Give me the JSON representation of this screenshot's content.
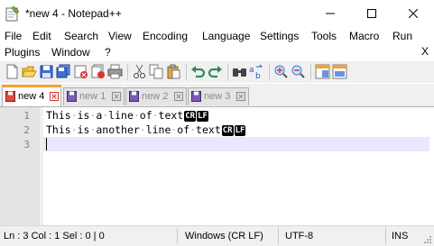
{
  "window": {
    "title": "*new 4 - Notepad++"
  },
  "menubar": {
    "items": [
      "File",
      "Edit",
      "Search",
      "View",
      "Encoding",
      "Language",
      "Settings",
      "Tools",
      "Macro",
      "Run",
      "Plugins",
      "Window",
      "?"
    ],
    "close_glyph": "X"
  },
  "toolbar": {
    "icons": [
      "new-file-icon",
      "open-file-icon",
      "save-icon",
      "save-all-icon",
      "close-icon",
      "close-all-icon",
      "print-icon",
      "cut-icon",
      "copy-icon",
      "paste-icon",
      "undo-icon",
      "redo-icon",
      "find-icon",
      "replace-icon",
      "zoom-in-icon",
      "zoom-out-icon",
      "sync-vertical-icon",
      "sync-horizontal-icon"
    ]
  },
  "tabs": [
    {
      "label": "new 4",
      "active": true
    },
    {
      "label": "new 1",
      "active": false
    },
    {
      "label": "new 2",
      "active": false
    },
    {
      "label": "new 3",
      "active": false
    }
  ],
  "editor": {
    "line_numbers": [
      "1",
      "2",
      "3"
    ],
    "lines": [
      {
        "words": [
          "This",
          "is",
          "a",
          "line",
          "of",
          "text"
        ],
        "eol": [
          "CR",
          "LF"
        ]
      },
      {
        "words": [
          "This",
          "is",
          "another",
          "line",
          "of",
          "text"
        ],
        "eol": [
          "CR",
          "LF"
        ]
      },
      {
        "words": [],
        "eol": []
      }
    ],
    "space_marker": "·"
  },
  "statusbar": {
    "position": "Ln : 3    Col : 1    Sel : 0 | 0",
    "eol_format": "Windows (CR LF)",
    "encoding": "UTF-8",
    "insert_mode": "INS"
  },
  "colors": {
    "tab_accent": "#f7a033",
    "current_line": "#e8e8ff",
    "gutter": "#e4e4e4",
    "eol_badge": "#000000"
  }
}
